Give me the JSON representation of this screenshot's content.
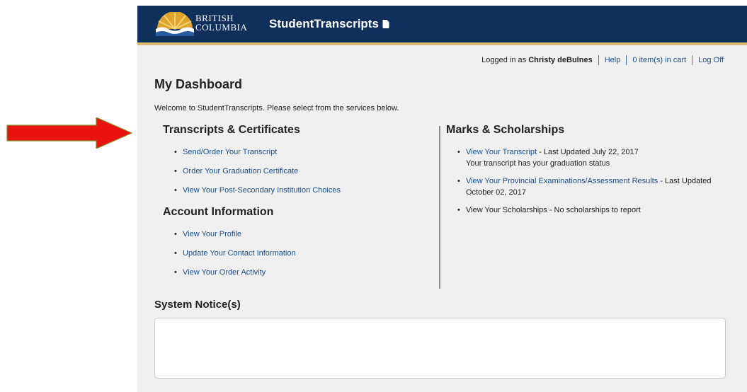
{
  "header": {
    "logo_line1": "BRITISH",
    "logo_line2": "COLUMBIA",
    "app_name": "StudentTranscripts",
    "logo_icon": "bc-sun-logo",
    "app_icon": "document-icon"
  },
  "topnav": {
    "logged_in_prefix": "Logged in as",
    "user_name": "Christy deBulnes",
    "help": "Help",
    "cart": "0 item(s) in cart",
    "logoff": "Log Off"
  },
  "dashboard": {
    "title": "My Dashboard",
    "welcome": "Welcome to StudentTranscripts. Please select from the services below."
  },
  "transcripts": {
    "heading": "Transcripts & Certificates",
    "items": [
      "Send/Order Your Transcript",
      "Order Your Graduation Certificate",
      "View Your Post-Secondary Institution Choices"
    ]
  },
  "account": {
    "heading": "Account Information",
    "items": [
      "View Your Profile",
      "Update Your Contact Information",
      "View Your Order Activity"
    ]
  },
  "marks": {
    "heading": "Marks & Scholarships",
    "items": [
      {
        "link": "View Your Transcript",
        "text": " - Last Updated July 22, 2017",
        "note": "Your transcript has your graduation status"
      },
      {
        "link": "View Your Provincial Examinations/Assessment Results",
        "text": " - Last Updated October 02, 2017",
        "note": ""
      },
      {
        "link": "",
        "text": "View Your Scholarships - No scholarships to report",
        "note": ""
      }
    ]
  },
  "notices": {
    "title": "System Notice(s)"
  },
  "colors": {
    "header_bg": "#0f2f5d",
    "header_accent": "#d9bb72",
    "link": "#1d4e89",
    "arrow": "#e8130f"
  }
}
